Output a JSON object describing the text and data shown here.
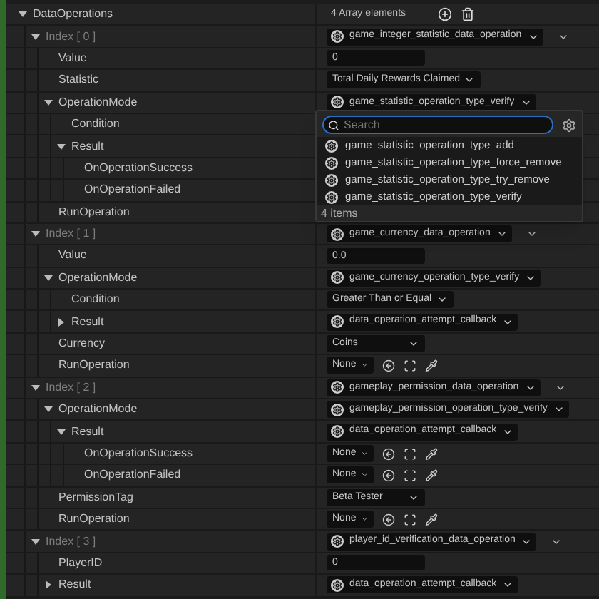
{
  "root": {
    "label": "DataOperations",
    "expanded": true,
    "value": {
      "kind": "header",
      "text": "4 Array elements"
    },
    "children": [
      {
        "label": "Index [ 0 ]",
        "index": true,
        "expanded": true,
        "value": {
          "kind": "array-asset",
          "text": "game_integer_statistic_data_operation"
        },
        "children": [
          {
            "label": "Value",
            "value": {
              "kind": "number",
              "text": "0"
            }
          },
          {
            "label": "Statistic",
            "value": {
              "kind": "combo",
              "text": "Total Daily Rewards Claimed"
            }
          },
          {
            "label": "OperationMode",
            "expanded": true,
            "value": {
              "kind": "asset",
              "text": "game_statistic_operation_type_verify"
            },
            "children": [
              {
                "label": "Condition"
              },
              {
                "label": "Result",
                "expanded": true,
                "children": [
                  {
                    "label": "OnOperationSuccess"
                  },
                  {
                    "label": "OnOperationFailed"
                  }
                ]
              }
            ]
          },
          {
            "label": "RunOperation"
          }
        ]
      },
      {
        "label": "Index [ 1 ]",
        "index": true,
        "expanded": true,
        "value": {
          "kind": "array-asset",
          "text": "game_currency_data_operation"
        },
        "children": [
          {
            "label": "Value",
            "value": {
              "kind": "number",
              "text": "0.0"
            }
          },
          {
            "label": "OperationMode",
            "expanded": true,
            "value": {
              "kind": "asset",
              "text": "game_currency_operation_type_verify"
            },
            "children": [
              {
                "label": "Condition",
                "value": {
                  "kind": "combo",
                  "text": "Greater Than or Equal"
                }
              },
              {
                "label": "Result",
                "expanded": false,
                "value": {
                  "kind": "asset",
                  "text": "data_operation_attempt_callback"
                }
              }
            ]
          },
          {
            "label": "Currency",
            "value": {
              "kind": "enum",
              "text": "Coins"
            }
          },
          {
            "label": "RunOperation",
            "value": {
              "kind": "picker",
              "text": "None"
            }
          }
        ]
      },
      {
        "label": "Index [ 2 ]",
        "index": true,
        "expanded": true,
        "value": {
          "kind": "array-asset",
          "text": "gameplay_permission_data_operation"
        },
        "children": [
          {
            "label": "OperationMode",
            "expanded": true,
            "value": {
              "kind": "asset",
              "text": "gameplay_permission_operation_type_verify"
            },
            "children": [
              {
                "label": "Result",
                "expanded": true,
                "value": {
                  "kind": "asset",
                  "text": "data_operation_attempt_callback"
                },
                "children": [
                  {
                    "label": "OnOperationSuccess",
                    "value": {
                      "kind": "picker",
                      "text": "None"
                    }
                  },
                  {
                    "label": "OnOperationFailed",
                    "value": {
                      "kind": "picker",
                      "text": "None"
                    }
                  }
                ]
              }
            ]
          },
          {
            "label": "PermissionTag",
            "value": {
              "kind": "enum",
              "text": "Beta Tester"
            }
          },
          {
            "label": "RunOperation",
            "value": {
              "kind": "picker",
              "text": "None"
            }
          }
        ]
      },
      {
        "label": "Index [ 3 ]",
        "index": true,
        "expanded": true,
        "value": {
          "kind": "array-asset",
          "text": "player_id_verification_data_operation"
        },
        "children": [
          {
            "label": "PlayerID",
            "value": {
              "kind": "number",
              "text": "0"
            }
          },
          {
            "label": "Result",
            "expanded": false,
            "value": {
              "kind": "asset",
              "text": "data_operation_attempt_callback"
            }
          }
        ]
      }
    ]
  },
  "popup": {
    "search": {
      "placeholder": "Search"
    },
    "items": [
      "game_statistic_operation_type_add",
      "game_statistic_operation_type_force_remove",
      "game_statistic_operation_type_try_remove",
      "game_statistic_operation_type_verify"
    ],
    "count": "4 items"
  }
}
